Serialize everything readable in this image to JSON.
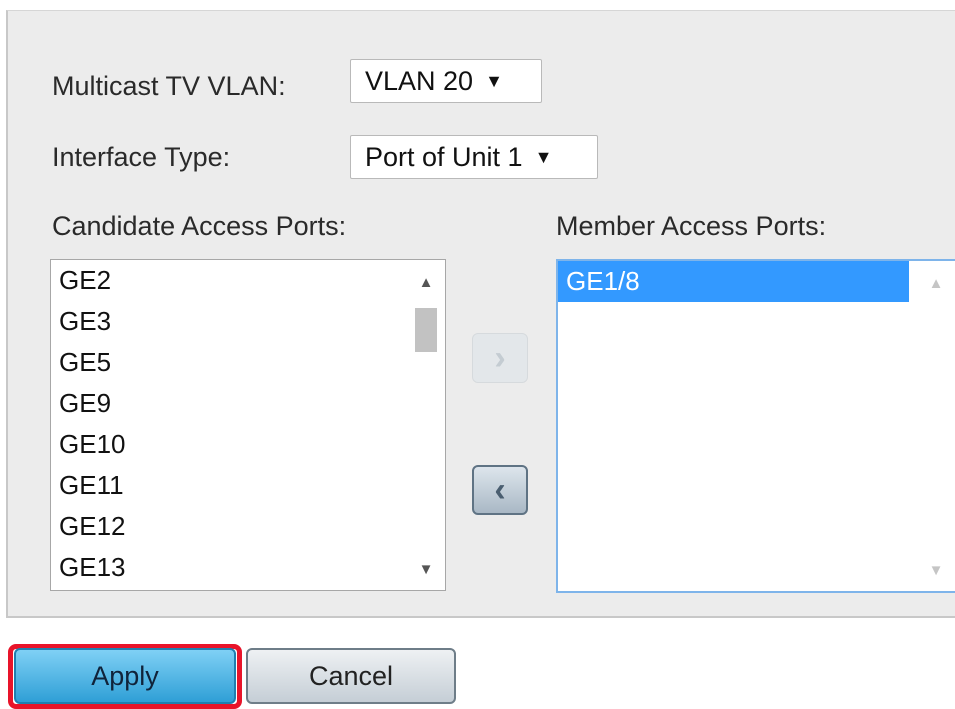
{
  "form": {
    "vlan_label": "Multicast TV VLAN:",
    "vlan_value": "VLAN 20",
    "interface_label": "Interface Type:",
    "interface_value": "Port of Unit 1"
  },
  "candidate": {
    "label": "Candidate Access Ports:",
    "items": [
      "GE2",
      "GE3",
      "GE5",
      "GE9",
      "GE10",
      "GE11",
      "GE12",
      "GE13"
    ]
  },
  "member": {
    "label": "Member Access Ports:",
    "items": [
      "GE1/8"
    ]
  },
  "buttons": {
    "add": "›",
    "remove": "‹",
    "apply": "Apply",
    "cancel": "Cancel"
  },
  "icons": {
    "dropdown": "triangle-down-icon",
    "scroll_up": "scroll-up-icon",
    "scroll_down": "scroll-down-icon"
  },
  "colors": {
    "selected_row": "#3399ff",
    "apply_highlight": "#e8142a"
  }
}
